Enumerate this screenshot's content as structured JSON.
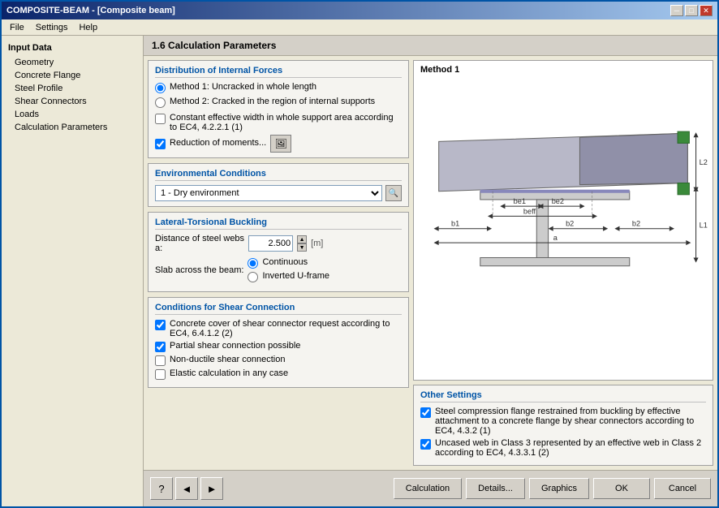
{
  "window": {
    "title": "COMPOSITE-BEAM - [Composite beam]",
    "title_bar_close": "✕",
    "title_bar_max": "□",
    "title_bar_min": "─"
  },
  "menu": {
    "items": [
      "File",
      "Settings",
      "Help"
    ]
  },
  "sidebar": {
    "header": "Input Data",
    "items": [
      {
        "label": "Geometry",
        "indent": true,
        "active": false
      },
      {
        "label": "Concrete Flange",
        "indent": true,
        "active": false
      },
      {
        "label": "Steel Profile",
        "indent": true,
        "active": false
      },
      {
        "label": "Shear Connectors",
        "indent": true,
        "active": false
      },
      {
        "label": "Loads",
        "indent": true,
        "active": false
      },
      {
        "label": "Calculation Parameters",
        "indent": true,
        "active": true
      }
    ]
  },
  "panel": {
    "title": "1.6 Calculation Parameters"
  },
  "distribution": {
    "title": "Distribution of Internal Forces",
    "method1_label": "Method 1: Uncracked in whole length",
    "method2_label": "Method 2: Cracked in the region of internal supports",
    "constant_width_label": "Constant effective width in whole support area according to EC4, 4.2.2.1 (1)",
    "reduction_label": "Reduction of moments..."
  },
  "env_conditions": {
    "title": "Environmental Conditions",
    "option": "1 - Dry environment"
  },
  "ltb": {
    "title": "Lateral-Torsional Buckling",
    "distance_label": "Distance of steel webs",
    "a_label": "a:",
    "a_value": "2.500",
    "unit": "[m]",
    "slab_label": "Slab across the beam:",
    "continuous": "Continuous",
    "inverted_u": "Inverted U-frame"
  },
  "shear_connection": {
    "title": "Conditions for Shear Connection",
    "concrete_cover_label": "Concrete cover of shear connector request according to EC4, 6.4.1.2 (2)",
    "partial_shear_label": "Partial shear connection possible",
    "non_ductile_label": "Non-ductile shear connection",
    "elastic_calc_label": "Elastic calculation in any case"
  },
  "diagram": {
    "method_label": "Method 1"
  },
  "other_settings": {
    "title": "Other Settings",
    "item1": "Steel compression flange restrained from buckling by effective attachment to a concrete flange by shear connectors according to EC4, 4.3.2 (1)",
    "item2": "Uncased web in Class 3 represented by an effective web in Class 2 according to EC4, 4.3.3.1 (2)"
  },
  "bottom": {
    "calculation_btn": "Calculation",
    "details_btn": "Details...",
    "graphics_btn": "Graphics",
    "ok_btn": "OK",
    "cancel_btn": "Cancel"
  }
}
